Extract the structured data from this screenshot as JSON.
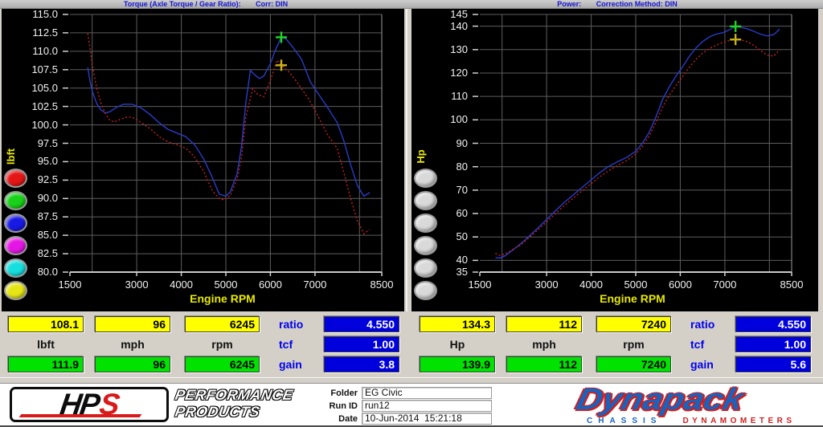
{
  "chart_data": [
    {
      "type": "line",
      "title": "Torque (Axle Torque / Gear Ratio):",
      "correction": "Corr: DIN",
      "xlabel": "Engine RPM",
      "ylabel": "lbft",
      "xlim": [
        1500,
        8500
      ],
      "ylim": [
        80,
        115
      ],
      "grid": true,
      "yticks": [
        {
          "value": 115,
          "label": "115.0"
        },
        {
          "value": 112.5,
          "label": "112.5"
        },
        {
          "value": 110,
          "label": "110.0"
        },
        {
          "value": 107.5,
          "label": "107.5"
        },
        {
          "value": 105,
          "label": "105.0"
        },
        {
          "value": 102.5,
          "label": "102.5"
        },
        {
          "value": 100,
          "label": "100.0"
        },
        {
          "value": 97.5,
          "label": "97.5"
        },
        {
          "value": 95,
          "label": "95.0"
        },
        {
          "value": 92.5,
          "label": "92.5"
        },
        {
          "value": 90,
          "label": "90.0"
        },
        {
          "value": 87.5,
          "label": "87.5"
        },
        {
          "value": 85,
          "label": "85.0"
        },
        {
          "value": 82.5,
          "label": "82.5"
        },
        {
          "value": 80,
          "label": "80.0"
        }
      ],
      "xticks": [
        {
          "value": 1500,
          "label": "1500"
        },
        {
          "value": 3000,
          "label": "3000"
        },
        {
          "value": 4000,
          "label": "4000"
        },
        {
          "value": 5000,
          "label": "5000"
        },
        {
          "value": 6000,
          "label": "6000"
        },
        {
          "value": 7000,
          "label": "7000"
        },
        {
          "value": 8500,
          "label": "8500"
        }
      ],
      "xgridlines": [
        2000,
        3000,
        4000,
        5000,
        6000,
        7000,
        8000
      ],
      "run_buttons": [
        "#e51616",
        "#19d119",
        "#1919e5",
        "#e516e5",
        "#16dede",
        "#e5e516"
      ],
      "series": [
        {
          "color": "#2a3cc8",
          "style": "solid",
          "points": [
            [
              1900,
              107.8
            ],
            [
              1950,
              106.0
            ],
            [
              2000,
              104.6
            ],
            [
              2100,
              102.9
            ],
            [
              2200,
              102.0
            ],
            [
              2300,
              101.6
            ],
            [
              2400,
              101.8
            ],
            [
              2550,
              102.4
            ],
            [
              2700,
              102.8
            ],
            [
              2900,
              102.8
            ],
            [
              3100,
              102.3
            ],
            [
              3300,
              101.4
            ],
            [
              3500,
              100.3
            ],
            [
              3700,
              99.4
            ],
            [
              3900,
              98.9
            ],
            [
              4100,
              98.4
            ],
            [
              4300,
              97.3
            ],
            [
              4500,
              95.4
            ],
            [
              4700,
              92.8
            ],
            [
              4850,
              90.6
            ],
            [
              5000,
              90.3
            ],
            [
              5100,
              90.9
            ],
            [
              5250,
              93.3
            ],
            [
              5350,
              97.0
            ],
            [
              5450,
              103.0
            ],
            [
              5550,
              107.4
            ],
            [
              5650,
              106.8
            ],
            [
              5750,
              106.3
            ],
            [
              5850,
              106.6
            ],
            [
              6000,
              108.3
            ],
            [
              6100,
              110.0
            ],
            [
              6245,
              111.9
            ],
            [
              6350,
              111.7
            ],
            [
              6500,
              110.6
            ],
            [
              6700,
              108.9
            ],
            [
              6900,
              105.8
            ],
            [
              7100,
              104.0
            ],
            [
              7300,
              102.2
            ],
            [
              7500,
              100.3
            ],
            [
              7650,
              97.8
            ],
            [
              7800,
              94.6
            ],
            [
              7950,
              91.8
            ],
            [
              8100,
              90.3
            ],
            [
              8230,
              90.8
            ]
          ]
        },
        {
          "color": "#c42020",
          "style": "dotted",
          "points": [
            [
              1900,
              112.4
            ],
            [
              1950,
              110.5
            ],
            [
              2000,
              108.2
            ],
            [
              2100,
              105.0
            ],
            [
              2200,
              102.9
            ],
            [
              2300,
              101.5
            ],
            [
              2400,
              100.6
            ],
            [
              2500,
              100.4
            ],
            [
              2650,
              100.8
            ],
            [
              2800,
              101.1
            ],
            [
              2950,
              100.9
            ],
            [
              3100,
              100.3
            ],
            [
              3300,
              99.5
            ],
            [
              3500,
              98.4
            ],
            [
              3700,
              97.7
            ],
            [
              3850,
              97.4
            ],
            [
              4000,
              97.1
            ],
            [
              4150,
              96.6
            ],
            [
              4300,
              95.6
            ],
            [
              4500,
              93.7
            ],
            [
              4700,
              91.0
            ],
            [
              4850,
              90.0
            ],
            [
              4950,
              89.8
            ],
            [
              5100,
              90.4
            ],
            [
              5250,
              92.6
            ],
            [
              5350,
              95.5
            ],
            [
              5450,
              101.0
            ],
            [
              5600,
              104.9
            ],
            [
              5700,
              104.2
            ],
            [
              5850,
              103.8
            ],
            [
              6000,
              106.0
            ],
            [
              6150,
              108.8
            ],
            [
              6245,
              108.1
            ],
            [
              6400,
              107.3
            ],
            [
              6550,
              106.2
            ],
            [
              6700,
              104.9
            ],
            [
              6850,
              103.6
            ],
            [
              7000,
              102.0
            ],
            [
              7150,
              100.2
            ],
            [
              7300,
              98.5
            ],
            [
              7500,
              96.8
            ],
            [
              7650,
              93.5
            ],
            [
              7800,
              90.0
            ],
            [
              7950,
              87.0
            ],
            [
              8100,
              85.2
            ],
            [
              8230,
              85.8
            ]
          ]
        }
      ],
      "cursors": [
        {
          "x": 6245,
          "y": 111.9,
          "color": "#21d421"
        },
        {
          "x": 6245,
          "y": 108.1,
          "color": "#c8b416"
        }
      ]
    },
    {
      "type": "line",
      "title": "Power:",
      "correction": "Correction Method: DIN",
      "xlabel": "Engine RPM",
      "ylabel": "Hp",
      "xlim": [
        1500,
        8500
      ],
      "ylim": [
        35,
        145
      ],
      "grid": true,
      "yticks": [
        {
          "value": 145,
          "label": "145"
        },
        {
          "value": 140,
          "label": "140"
        },
        {
          "value": 130,
          "label": "130"
        },
        {
          "value": 120,
          "label": "120"
        },
        {
          "value": 110,
          "label": "110"
        },
        {
          "value": 100,
          "label": "100"
        },
        {
          "value": 90,
          "label": "90"
        },
        {
          "value": 80,
          "label": "80"
        },
        {
          "value": 70,
          "label": "70"
        },
        {
          "value": 60,
          "label": "60"
        },
        {
          "value": 50,
          "label": "50"
        },
        {
          "value": 40,
          "label": "40"
        },
        {
          "value": 35,
          "label": "35"
        }
      ],
      "xticks": [
        {
          "value": 1500,
          "label": "1500"
        },
        {
          "value": 3000,
          "label": "3000"
        },
        {
          "value": 4000,
          "label": "4000"
        },
        {
          "value": 5000,
          "label": "5000"
        },
        {
          "value": 6000,
          "label": "6000"
        },
        {
          "value": 7000,
          "label": "7000"
        },
        {
          "value": 8500,
          "label": "8500"
        }
      ],
      "xgridlines": [
        2000,
        3000,
        4000,
        5000,
        6000,
        7000,
        8000
      ],
      "run_buttons": [
        "#d9d9d9",
        "#d9d9d9",
        "#d9d9d9",
        "#d9d9d9",
        "#d9d9d9",
        "#d9d9d9"
      ],
      "series": [
        {
          "color": "#2a3cc8",
          "style": "solid",
          "points": [
            [
              1850,
              41.2
            ],
            [
              1950,
              41.0
            ],
            [
              2050,
              41.8
            ],
            [
              2200,
              43.8
            ],
            [
              2400,
              46.8
            ],
            [
              2600,
              50.2
            ],
            [
              2800,
              53.8
            ],
            [
              3000,
              57.4
            ],
            [
              3200,
              61.2
            ],
            [
              3400,
              64.8
            ],
            [
              3600,
              68.0
            ],
            [
              3800,
              71.2
            ],
            [
              4000,
              74.4
            ],
            [
              4200,
              77.6
            ],
            [
              4400,
              80.2
            ],
            [
              4600,
              82.2
            ],
            [
              4800,
              84.0
            ],
            [
              5000,
              86.6
            ],
            [
              5150,
              90.0
            ],
            [
              5300,
              94.6
            ],
            [
              5450,
              101.0
            ],
            [
              5600,
              108.6
            ],
            [
              5750,
              114.0
            ],
            [
              5900,
              118.6
            ],
            [
              6050,
              122.6
            ],
            [
              6200,
              127.0
            ],
            [
              6350,
              130.6
            ],
            [
              6500,
              133.4
            ],
            [
              6650,
              135.4
            ],
            [
              6800,
              136.6
            ],
            [
              6950,
              137.2
            ],
            [
              7100,
              138.4
            ],
            [
              7240,
              139.9
            ],
            [
              7350,
              139.6
            ],
            [
              7500,
              138.9
            ],
            [
              7650,
              137.8
            ],
            [
              7800,
              136.6
            ],
            [
              7950,
              135.8
            ],
            [
              8100,
              136.4
            ],
            [
              8230,
              138.8
            ]
          ]
        },
        {
          "color": "#c42020",
          "style": "dotted",
          "points": [
            [
              1850,
              43.0
            ],
            [
              1950,
              42.2
            ],
            [
              2050,
              42.6
            ],
            [
              2200,
              44.2
            ],
            [
              2400,
              46.4
            ],
            [
              2600,
              49.6
            ],
            [
              2800,
              53.0
            ],
            [
              3000,
              56.4
            ],
            [
              3200,
              60.0
            ],
            [
              3400,
              63.4
            ],
            [
              3600,
              66.6
            ],
            [
              3800,
              69.8
            ],
            [
              4000,
              72.8
            ],
            [
              4200,
              75.8
            ],
            [
              4400,
              78.4
            ],
            [
              4600,
              80.6
            ],
            [
              4800,
              82.6
            ],
            [
              5000,
              85.4
            ],
            [
              5150,
              88.6
            ],
            [
              5300,
              93.0
            ],
            [
              5450,
              98.8
            ],
            [
              5600,
              105.4
            ],
            [
              5750,
              110.4
            ],
            [
              5900,
              114.6
            ],
            [
              6050,
              118.4
            ],
            [
              6200,
              122.4
            ],
            [
              6350,
              125.8
            ],
            [
              6500,
              128.4
            ],
            [
              6650,
              130.4
            ],
            [
              6800,
              131.8
            ],
            [
              6950,
              133.0
            ],
            [
              7100,
              133.9
            ],
            [
              7240,
              134.3
            ],
            [
              7350,
              134.2
            ],
            [
              7500,
              133.4
            ],
            [
              7650,
              131.8
            ],
            [
              7800,
              129.6
            ],
            [
              7950,
              127.6
            ],
            [
              8100,
              127.2
            ],
            [
              8230,
              130.0
            ]
          ]
        }
      ],
      "cursors": [
        {
          "x": 7240,
          "y": 139.9,
          "color": "#21d421"
        },
        {
          "x": 7240,
          "y": 134.3,
          "color": "#c8b416"
        }
      ]
    }
  ],
  "panels": [
    {
      "cursor_row": [
        "108.1",
        "96",
        "6245"
      ],
      "units": [
        "lbft",
        "mph",
        "rpm"
      ],
      "run_row": [
        "111.9",
        "96",
        "6245"
      ],
      "params": [
        {
          "label": "ratio",
          "value": "4.550"
        },
        {
          "label": "tcf",
          "value": "1.00"
        },
        {
          "label": "gain",
          "value": "3.8"
        }
      ]
    },
    {
      "cursor_row": [
        "134.3",
        "112",
        "7240"
      ],
      "units": [
        "Hp",
        "mph",
        "rpm"
      ],
      "run_row": [
        "139.9",
        "112",
        "7240"
      ],
      "params": [
        {
          "label": "ratio",
          "value": "4.550"
        },
        {
          "label": "tcf",
          "value": "1.00"
        },
        {
          "label": "gain",
          "value": "5.6"
        }
      ]
    }
  ],
  "footer": {
    "hps": {
      "hp": "HP",
      "s": "S",
      "line1": "PERFORMANCE",
      "line2": "PRODUCTS"
    },
    "fields": [
      {
        "label": "Folder",
        "value": "EG Civic"
      },
      {
        "label": "Run ID",
        "value": "run12"
      },
      {
        "label": "Date",
        "value": "10-Jun-2014  15:21:18"
      }
    ],
    "dynapack": {
      "wordmark": "Dynapack",
      "chassis": "CHASSIS",
      "dynos": "DYNAMOMETERS"
    }
  }
}
